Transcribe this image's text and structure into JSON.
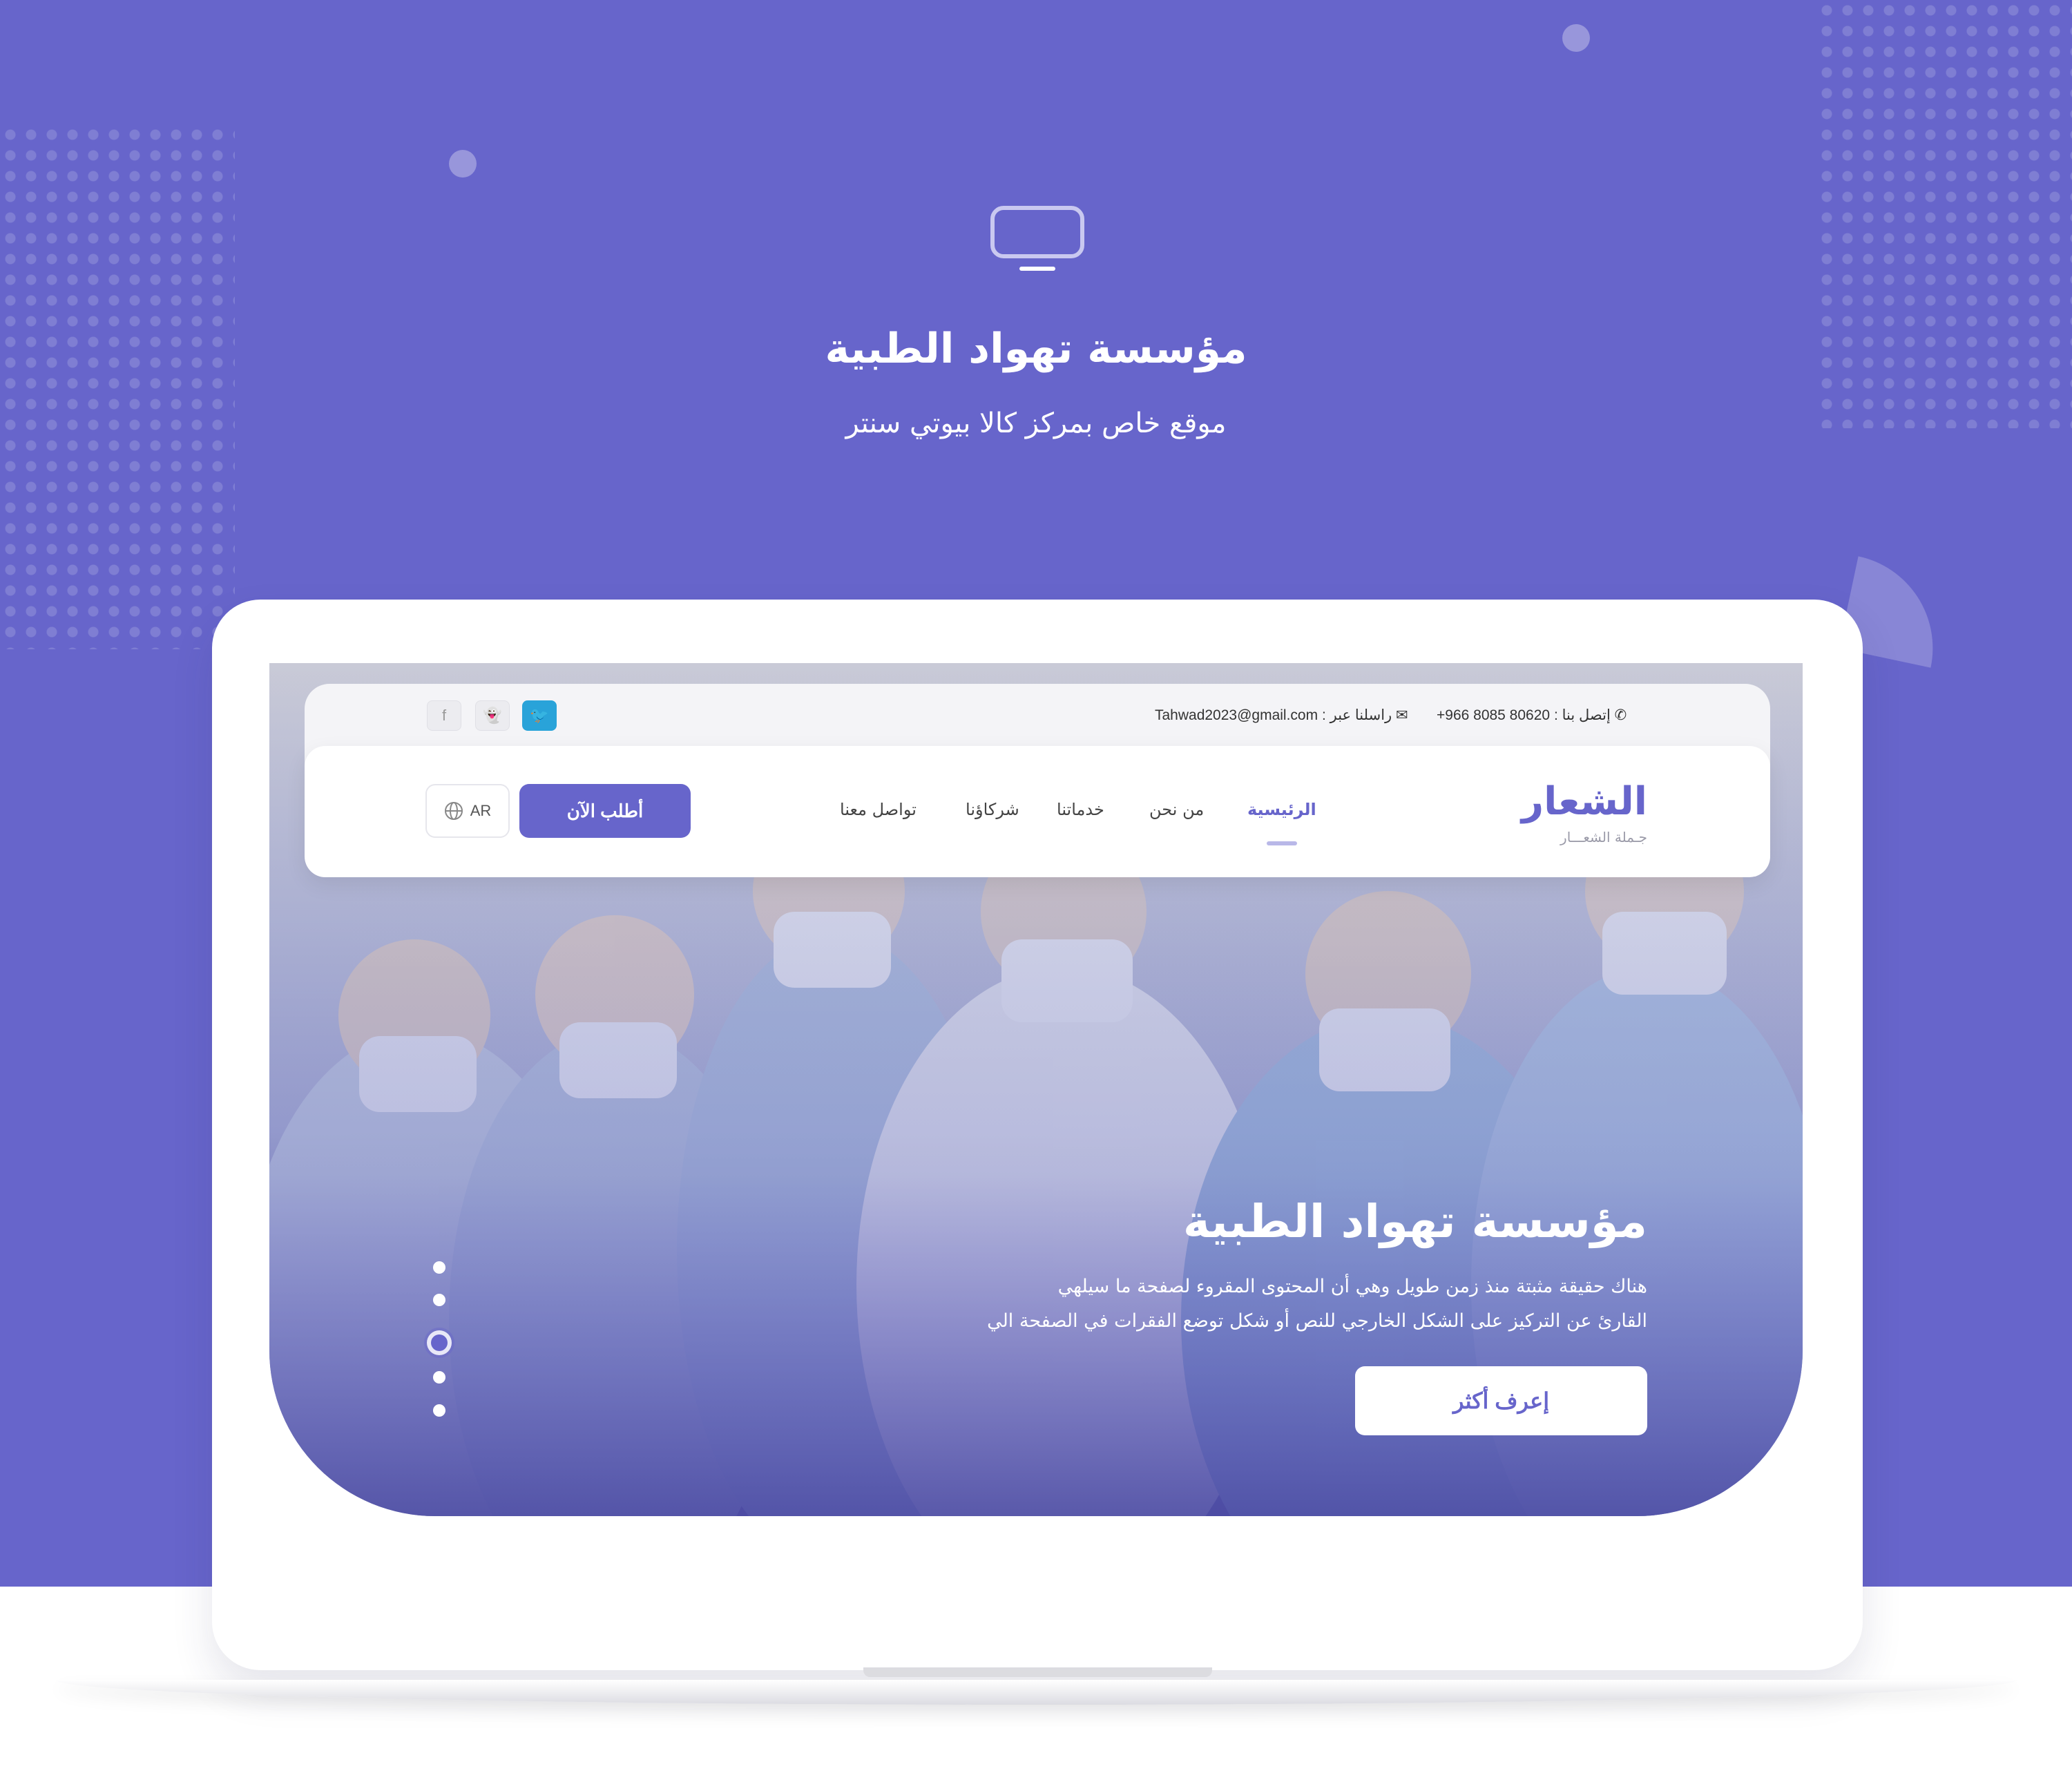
{
  "colors": {
    "accent": "#6765CB",
    "background": "#6765CB",
    "twitter": "#29A3D9"
  },
  "header": {
    "monitor_icon": "monitor-icon",
    "title": "مؤسسة تهواد الطبية",
    "subtitle": "موقع خاص بمركز كالا بيوتي سنتر"
  },
  "topbar": {
    "phone_label": "إتصل بنا :",
    "phone": "+966 8085 80620",
    "email_label": "راسلنا عبر :",
    "email": "Tahwad2023@gmail.com",
    "social": [
      {
        "icon": "twitter-icon",
        "glyph": "🐦"
      },
      {
        "icon": "snapchat-icon",
        "glyph": "👻"
      },
      {
        "icon": "facebook-icon",
        "glyph": "f"
      }
    ]
  },
  "navbar": {
    "logo": "الشعار",
    "logo_tagline": "جـملة الشعـــار",
    "items": [
      {
        "label": "الرئيسية",
        "active": true
      },
      {
        "label": "من نحن",
        "active": false
      },
      {
        "label": "خدماتنا",
        "active": false
      },
      {
        "label": "شركاؤنا",
        "active": false
      },
      {
        "label": "تواصل معنا",
        "active": false
      }
    ],
    "cta_label": "أطلب الآن",
    "lang_label": "AR"
  },
  "hero": {
    "title": "مؤسسة تهواد الطبية",
    "line1": "هناك حقيقة مثبتة منذ زمن طويل وهي أن المحتوى المقروء لصفحة ما سيلهي",
    "line2": "القارئ عن التركيز على الشكل الخارجي للنص أو شكل توضع الفقرات في الصفحة الي",
    "button_label": "إعرف أكثر",
    "slides_count": 5,
    "active_slide": 3
  }
}
